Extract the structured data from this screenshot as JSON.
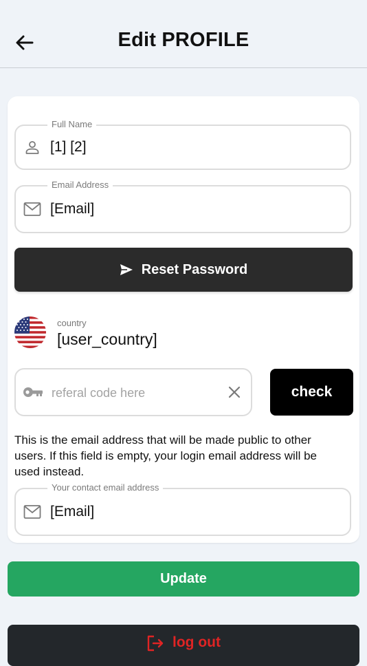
{
  "header": {
    "title": "Edit PROFILE",
    "back_icon": "arrow-left-icon"
  },
  "form": {
    "full_name": {
      "label": "Full Name",
      "value": "[1] [2]",
      "icon": "person-icon"
    },
    "email": {
      "label": "Email Address",
      "value": "[Email]",
      "icon": "mail-icon"
    },
    "reset_password": {
      "label": "Reset Password",
      "icon": "send-icon"
    },
    "country": {
      "label": "country",
      "value": "[user_country]",
      "flag": "us-flag-icon"
    },
    "referral": {
      "placeholder": "referal code here",
      "value": "",
      "icon": "key-icon",
      "clear_icon": "close-icon"
    },
    "check_label": "check",
    "contact_note": "This is the email address that will be made public to other users. If this field is empty, your login email address will be used instead.",
    "contact_email": {
      "label": "Your contact email address",
      "value": "[Email]",
      "icon": "mail-icon"
    }
  },
  "actions": {
    "update_label": "Update",
    "logout_label": "log out",
    "logout_icon": "logout-icon"
  },
  "colors": {
    "background": "#eff3f8",
    "reset_button": "#2b2b2b",
    "update_button": "#25a661",
    "logout_button": "#23272b",
    "logout_text": "#e02424"
  }
}
